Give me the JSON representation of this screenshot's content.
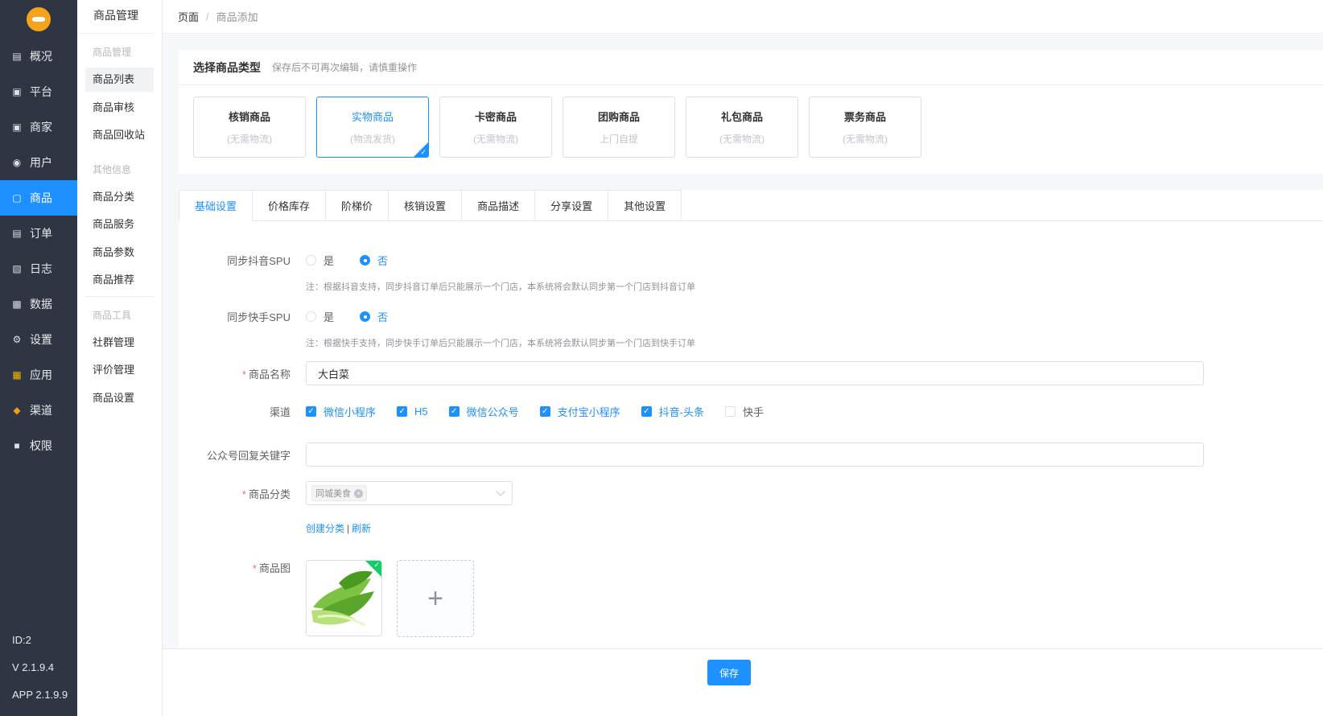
{
  "sidebar": {
    "items": [
      {
        "label": "概况",
        "icon": "chart-icon"
      },
      {
        "label": "平台",
        "icon": "monitor-icon"
      },
      {
        "label": "商家",
        "icon": "store-icon"
      },
      {
        "label": "用户",
        "icon": "user-icon"
      },
      {
        "label": "商品",
        "icon": "bag-icon"
      },
      {
        "label": "订单",
        "icon": "order-icon"
      },
      {
        "label": "日志",
        "icon": "book-icon"
      },
      {
        "label": "数据",
        "icon": "bar-chart-icon"
      },
      {
        "label": "设置",
        "icon": "gear-icon"
      },
      {
        "label": "应用",
        "icon": "apps-icon"
      },
      {
        "label": "渠道",
        "icon": "cube-icon"
      },
      {
        "label": "权限",
        "icon": "lock-icon"
      }
    ],
    "active_index": 4,
    "id": "ID:2",
    "version": "V 2.1.9.4",
    "app_version": "APP 2.1.9.9"
  },
  "submenu": {
    "title": "商品管理",
    "group1": "商品管理",
    "group1_items": [
      "商品列表",
      "商品审核",
      "商品回收站"
    ],
    "group2": "其他信息",
    "group2_items": [
      "商品分类",
      "商品服务",
      "商品参数",
      "商品推荐"
    ],
    "group3": "商品工具",
    "group3_items": [
      "社群管理",
      "评价管理",
      "商品设置"
    ]
  },
  "breadcrumb": {
    "root": "页面",
    "separator": "/",
    "current": "商品添加"
  },
  "product_type": {
    "heading": "选择商品类型",
    "note": "保存后不可再次编辑，请慎重操作",
    "types": [
      {
        "name": "核销商品",
        "sub": "(无需物流)"
      },
      {
        "name": "实物商品",
        "sub": "(物流发货)"
      },
      {
        "name": "卡密商品",
        "sub": "(无需物流)"
      },
      {
        "name": "团购商品",
        "sub": "上门自提"
      },
      {
        "name": "礼包商品",
        "sub": "(无需物流)"
      },
      {
        "name": "票务商品",
        "sub": "(无需物流)"
      }
    ],
    "selected_index": 1
  },
  "tabs": [
    "基础设置",
    "价格库存",
    "阶梯价",
    "核销设置",
    "商品描述",
    "分享设置",
    "其他设置"
  ],
  "form": {
    "douyin_spu": {
      "label": "同步抖音SPU",
      "yes": "是",
      "no": "否",
      "value": "否",
      "tip": "注：根据抖音支持，同步抖音订单后只能展示一个门店，本系统将会默认同步第一个门店到抖音订单"
    },
    "kuaishou_spu": {
      "label": "同步快手SPU",
      "yes": "是",
      "no": "否",
      "value": "否",
      "tip": "注：根据快手支持，同步快手订单后只能展示一个门店，本系统将会默认同步第一个门店到快手订单"
    },
    "name": {
      "label": "商品名称",
      "value": "大白菜"
    },
    "channels": {
      "label": "渠道",
      "options": [
        {
          "label": "微信小程序",
          "checked": true
        },
        {
          "label": "H5",
          "checked": true
        },
        {
          "label": "微信公众号",
          "checked": true
        },
        {
          "label": "支付宝小程序",
          "checked": true
        },
        {
          "label": "抖音-头条",
          "checked": true
        },
        {
          "label": "快手",
          "checked": false
        }
      ]
    },
    "keyword": {
      "label": "公众号回复关键字",
      "value": ""
    },
    "category": {
      "label": "商品分类",
      "tag": "同城美食",
      "create_link": "创建分类",
      "divider": "|",
      "refresh_link": "刷新"
    },
    "image": {
      "label": "商品图",
      "upload_symbol": "+"
    }
  },
  "footer": {
    "save_label": "保存"
  },
  "colors": {
    "primary": "#1e90ff",
    "sidebar_bg": "#2f3542",
    "success": "#13ce66"
  }
}
